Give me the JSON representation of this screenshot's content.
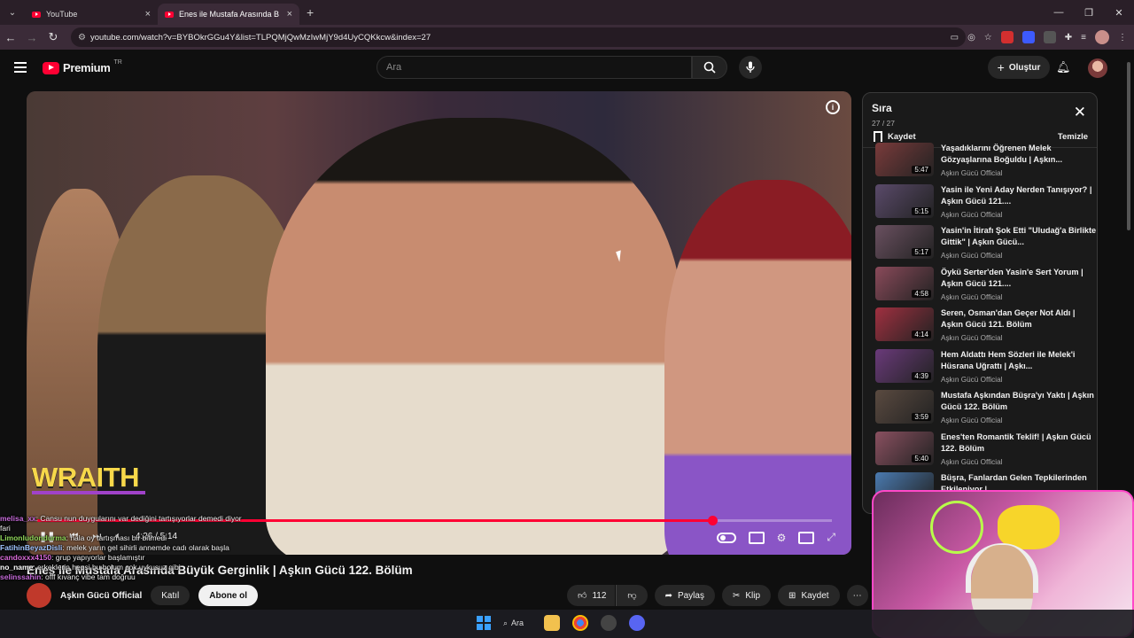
{
  "browser": {
    "tabs": [
      {
        "label": "YouTube"
      },
      {
        "label": "Enes ile Mustafa Arasında B"
      }
    ],
    "url": "youtube.com/watch?v=BYBOkrGGu4Y&list=TLPQMjQwMzIwMjY9d4UyCQKkcw&index=27"
  },
  "header": {
    "logo_text": "Premium",
    "logo_region": "TR",
    "search_placeholder": "Ara",
    "create_label": "Oluştur"
  },
  "player": {
    "overlay_text": "WRAITH",
    "time": "4:26 / 5:14",
    "progress": 0.85
  },
  "video": {
    "title": "Enes ile Mustafa Arasında Büyük Gerginlik | Aşkın Gücü 122. Bölüm",
    "channel": "Aşkın Gücü Official",
    "join_label": "Katıl",
    "subscribe_label": "Abone ol",
    "like_count": "112",
    "share_label": "Paylaş",
    "clip_label": "Klip",
    "save_label": "Kaydet"
  },
  "queue": {
    "title": "Sıra",
    "count": "27 / 27",
    "save_label": "Kaydet",
    "clear_label": "Temizle",
    "items": [
      {
        "title": "Yaşadıklarını Öğrenen Melek Gözyaşlarına Boğuldu | Aşkın...",
        "channel": "Aşkın Gücü Official",
        "duration": "5:47",
        "color": "#7a3b3b"
      },
      {
        "title": "Yasin ile Yeni Aday Nerden Tanışıyor? | Aşkın Gücü 121....",
        "channel": "Aşkın Gücü Official",
        "duration": "5:15",
        "color": "#5a4a6a"
      },
      {
        "title": "Yasin'in İtirafı Şok Etti \"Uludağ'a Birlikte Gittik\" | Aşkın Gücü...",
        "channel": "Aşkın Gücü Official",
        "duration": "5:17",
        "color": "#6a5060"
      },
      {
        "title": "Öykü Serter'den Yasin'e Sert Yorum | Aşkın Gücü 121....",
        "channel": "Aşkın Gücü Official",
        "duration": "4:58",
        "color": "#8a4a5a"
      },
      {
        "title": "Seren, Osman'dan Geçer Not Aldı | Aşkın Gücü 121. Bölüm",
        "channel": "Aşkın Gücü Official",
        "duration": "4:14",
        "color": "#a03040"
      },
      {
        "title": "Hem Aldattı Hem Sözleri ile Melek'i Hüsrana Uğrattı | Aşkı...",
        "channel": "Aşkın Gücü Official",
        "duration": "4:39",
        "color": "#6a3a7a"
      },
      {
        "title": "Mustafa Aşkından Büşra'yı Yaktı | Aşkın Gücü 122. Bölüm",
        "channel": "Aşkın Gücü Official",
        "duration": "3:59",
        "color": "#5a4a40"
      },
      {
        "title": "Enes'ten Romantik Teklif! | Aşkın Gücü 122. Bölüm",
        "channel": "Aşkın Gücü Official",
        "duration": "5:40",
        "color": "#8a5060"
      },
      {
        "title": "Büşra, Fanlardan Gelen Tepkilerinden Etkileniyor |...",
        "channel": "Aşkın Gücü Official",
        "duration": "",
        "color": "#4a7ab0"
      }
    ]
  },
  "chat": [
    {
      "user": "melisa_xx",
      "text": ": Cansu nun duygularını var dediğini tartışıyorlar demedi diyor fari",
      "color": "#c56ad8"
    },
    {
      "user": "Limonludondurma",
      "text": ": hala oy tartışması bir bitmedi",
      "color": "#8fd65a"
    },
    {
      "user": "FatihinBeyazDisli",
      "text": ": melek yarın gel sihirli annemde cadı olarak başla",
      "color": "#a0c4ff"
    },
    {
      "user": "candoxxx4150",
      "text": ": grup yapıyorlar başlamıştır",
      "color": "#d86ad8"
    },
    {
      "user": "no_name",
      "text": ": erkeklerin hepsi bu bolum cok uykusuz gibi",
      "color": "#ffffff"
    },
    {
      "user": "selinssahin",
      "text": ": offf kıvanç vibe tam doğruu",
      "color": "#c56ad8"
    }
  ],
  "taskbar": {
    "search_label": "Ara"
  }
}
